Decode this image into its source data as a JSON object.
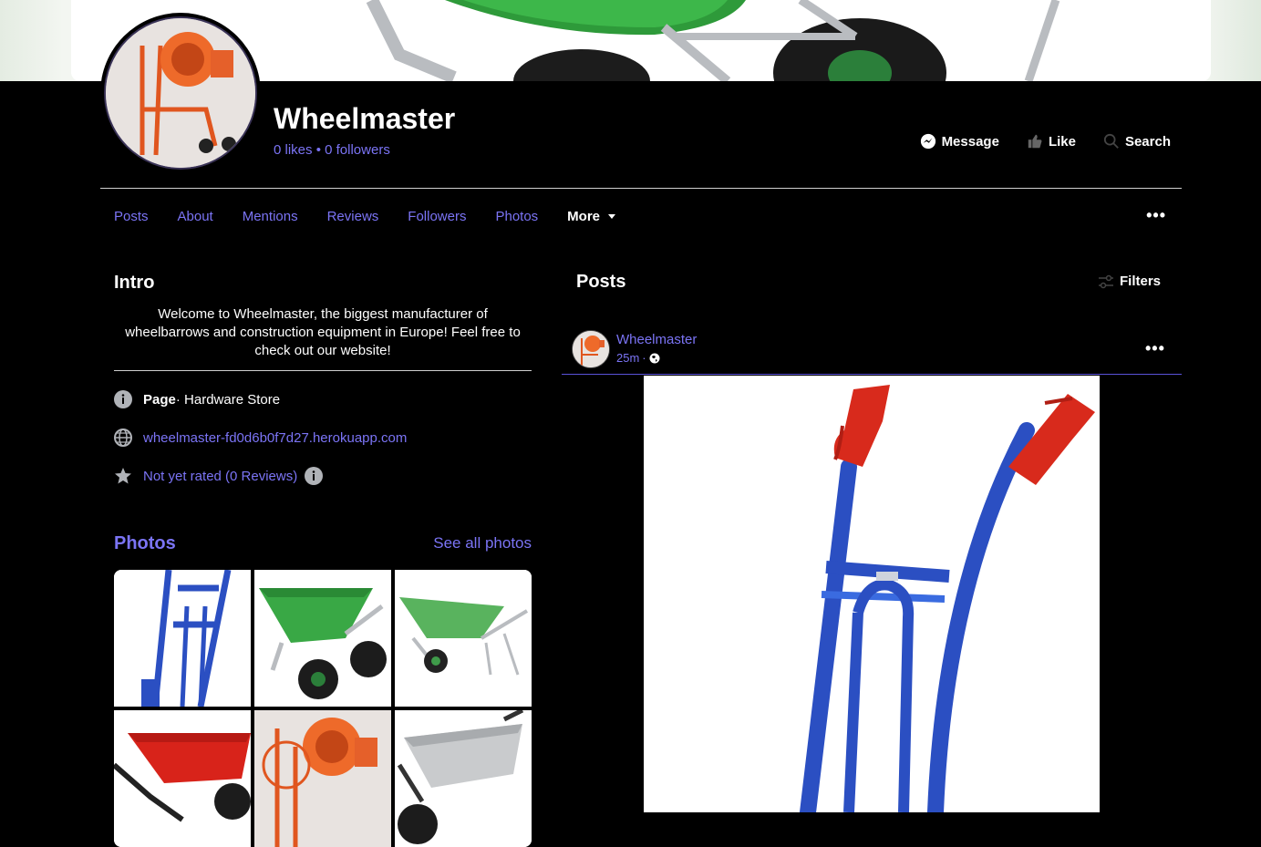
{
  "page": {
    "name": "Wheelmaster",
    "likes": "0 likes",
    "dot": " • ",
    "followers": "0 followers"
  },
  "actions": {
    "message": "Message",
    "like": "Like",
    "search": "Search"
  },
  "tabs": [
    "Posts",
    "About",
    "Mentions",
    "Reviews",
    "Followers",
    "Photos",
    "More"
  ],
  "intro": {
    "title": "Intro",
    "text": "Welcome to Wheelmaster, the biggest manufacturer of wheelbarrows and construction equipment in Europe! Feel free to check out our website!",
    "category_label": "Page",
    "category_value": " · Hardware Store",
    "website": "wheelmaster-fd0d6b0f7d27.herokuapp.com",
    "rating": "Not yet rated (0 Reviews)"
  },
  "photos": {
    "title": "Photos",
    "see_all": "See all photos"
  },
  "posts": {
    "title": "Posts",
    "filters": "Filters",
    "author": "Wheelmaster",
    "time": "25m",
    "time_sep": " · "
  },
  "colors": {
    "accent": "#7b74f5",
    "background": "#000000",
    "cover_green": "#2e9a3a"
  },
  "icons": [
    "messenger-icon",
    "thumbs-up-icon",
    "search-icon",
    "more-dots-icon",
    "info-icon",
    "globe-icon",
    "star-icon",
    "filters-icon",
    "caret-down-icon"
  ]
}
